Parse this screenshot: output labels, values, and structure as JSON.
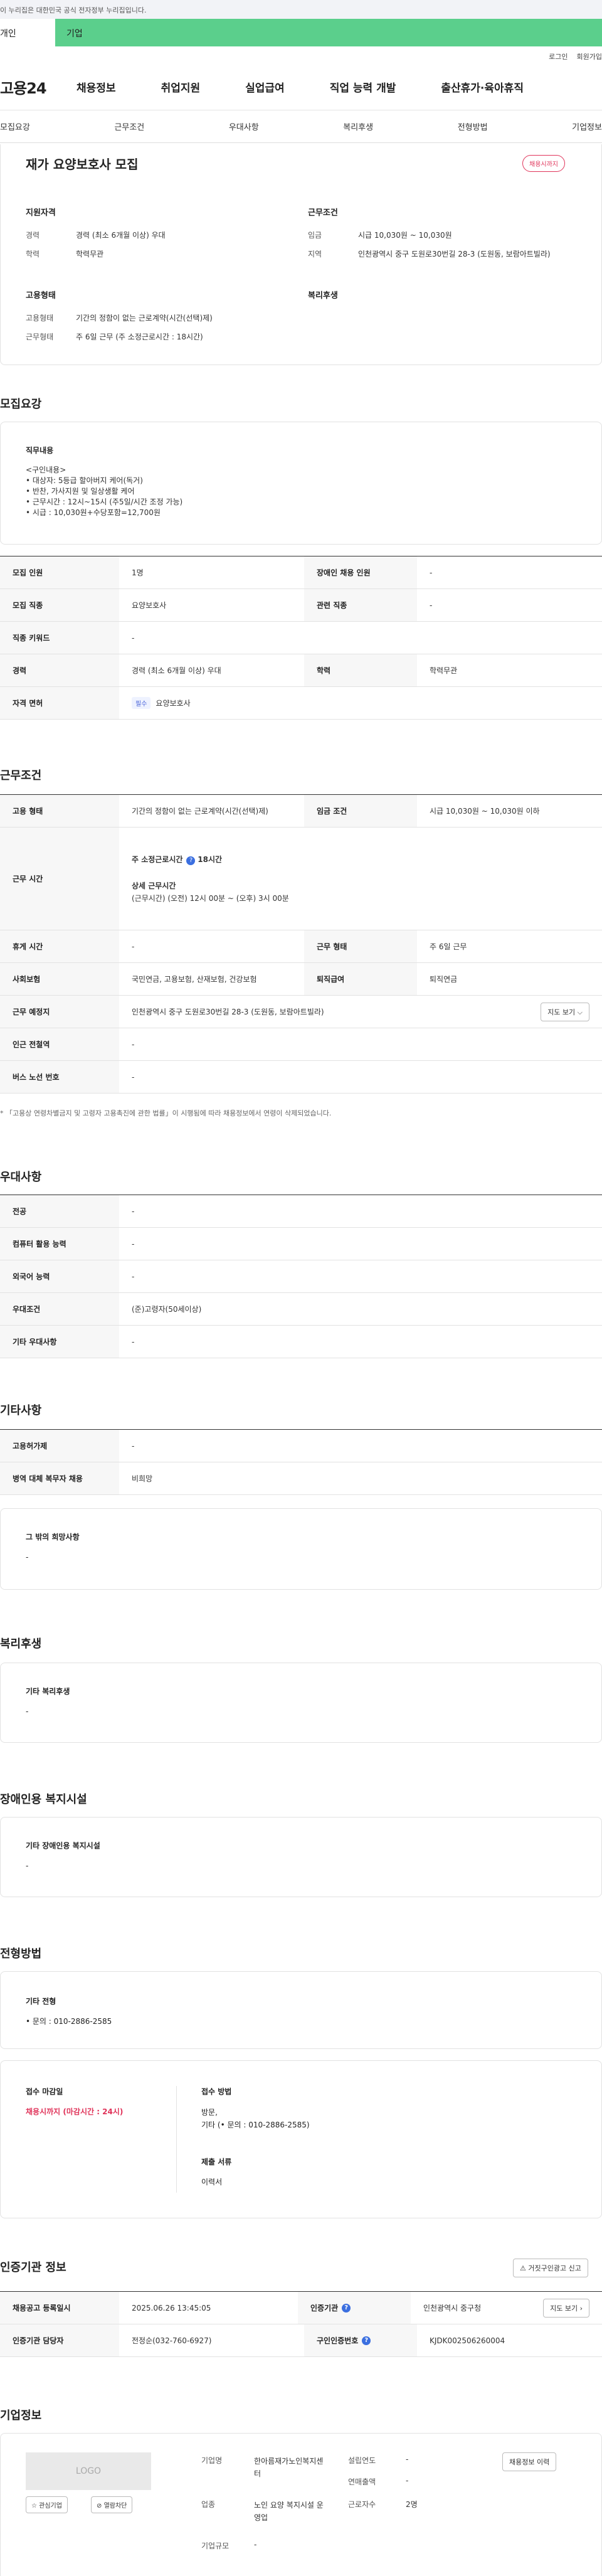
{
  "gov_banner": "이 누리집은 대한민국 공식 전자정부 누리집입니다.",
  "top_tabs": {
    "tab1": "개인",
    "tab2": "기업"
  },
  "util": {
    "login": "로그인",
    "join": "회원가입"
  },
  "header": {
    "logo": "고용24",
    "menu": [
      "채용정보",
      "취업지원",
      "실업급여",
      "직업 능력 개발",
      "출산휴가·육아휴직"
    ]
  },
  "subnav": [
    "모집요강",
    "근무조건",
    "우대사항",
    "복리후생",
    "전형방법",
    "기업정보"
  ],
  "job": {
    "title": "재가 요양보호사 모집",
    "status_badge": "채용시까지",
    "qual_head": "지원자격",
    "cond_head": "근무조건",
    "career_label": "경력",
    "career_value": "경력 (최소 6개월 이상) 우대",
    "edu_label": "학력",
    "edu_value": "학력무관",
    "wage_label": "임금",
    "wage_value": "시급 10,030원 ~ 10,030원",
    "area_label": "지역",
    "area_value": "인천광역시 중구 도원로30번길 28-3 (도원동, 보람아트빌라)",
    "emp_head": "고용형태",
    "welfare_head": "복리후생",
    "emp_label": "고용형태",
    "emp_value": "기간의 정함이 없는 근로계약(시간(선택)제)",
    "work_label": "근무형태",
    "work_value": "주 6일 근무 (주 소정근로시간 : 18시간)"
  },
  "recruit": {
    "heading": "모집요강",
    "duty_title": "직무내용",
    "duty_lines": [
      "<구인내용>",
      "• 대상자: 5등급 할아버지 케어(독거)",
      "• 반찬, 가사지원 및 일상생활 케어",
      "• 근무시간 : 12시~15시 (주5일/시간 조정 가능)",
      "• 시급 : 10,030원+수당포함=12,700원"
    ],
    "rows": [
      {
        "l1": "모집 인원",
        "v1": "1명",
        "l2": "장애인 채용 인원",
        "v2": "-"
      },
      {
        "l1": "모집 직종",
        "v1": "요양보호사",
        "l2": "관련 직종",
        "v2": "-"
      },
      {
        "l1": "직종 키워드",
        "v1": "-"
      },
      {
        "l1": "경력",
        "v1": "경력 (최소 6개월 이상) 우대",
        "l2": "학력",
        "v2": "학력무관"
      },
      {
        "l1": "자격 면허",
        "badge": "필수",
        "v1": "요양보호사"
      }
    ]
  },
  "conditions": {
    "heading": "근무조건",
    "emp_label": "고용 형태",
    "emp_value": "기간의 정함이 없는 근로계약(시간(선택)제)",
    "wage_label": "임금 조건",
    "wage_value": "시급 10,030원 ~ 10,030원 이하",
    "hours_label": "근무 시간",
    "hours_main": "주 소정근로시간",
    "hours_main_value": "18시간",
    "hours_detail_title": "상세 근무시간",
    "hours_detail": "(근무시간) (오전) 12시 00분 ~ (오후) 3시 00분",
    "rest_label": "휴게 시간",
    "rest_value": "-",
    "form_label": "근무 형태",
    "form_value": "주 6일 근무",
    "ins_label": "사회보험",
    "ins_value": "국민연금, 고용보험, 산재보험, 건강보험",
    "ret_label": "퇴직급여",
    "ret_value": "퇴직연금",
    "place_label": "근무 예정지",
    "place_value": "인천광역시 중구 도원로30번길 28-3 (도원동, 보람아트빌라)",
    "map_btn": "지도 보기",
    "station_label": "인근 전철역",
    "station_value": "-",
    "bus_label": "버스 노선 번호",
    "bus_value": "-",
    "note": "* 「고용상 연령차별금지 및 고령자 고용촉진에 관한 법률」이 시행됨에 따라 채용정보에서 연령이 삭제되었습니다."
  },
  "prefs": {
    "heading": "우대사항",
    "rows": [
      {
        "l": "전공",
        "v": "-"
      },
      {
        "l": "컴퓨터 활용 능력",
        "v": "-"
      },
      {
        "l": "외국어 능력",
        "v": "-"
      },
      {
        "l": "우대조건",
        "v": "(준)고령자(50세이상)"
      },
      {
        "l": "기타 우대사항",
        "v": "-"
      }
    ]
  },
  "etc": {
    "heading": "기타사항",
    "rows": [
      {
        "l": "고용허가제",
        "v": "-"
      },
      {
        "l": "병역 대체 복무자 채용",
        "v": "비희망"
      }
    ],
    "other_title": "그 밖의 희망사항",
    "other_value": "-"
  },
  "welfare": {
    "heading": "복리후생",
    "title": "기타 복리후생",
    "value": "-"
  },
  "disabled": {
    "heading": "장애인용 복지시설",
    "title": "기타 장애인용 복지시설",
    "value": "-"
  },
  "process": {
    "heading": "전형방법",
    "etc_title": "기타 전형",
    "etc_value": "• 문의 : 010-2886-2585",
    "deadline_title": "접수 마감일",
    "deadline_value": "채용시까지 (마감시간 : 24시)",
    "method_title": "접수 방법",
    "method_value1": "방문,",
    "method_value2": "기타 (• 문의 : 010-2886-2585)",
    "docs_title": "제출 서류",
    "docs_value": "이력서"
  },
  "cert": {
    "heading": "인증기관 정보",
    "report_btn": "거짓구인광고 신고",
    "reg_label": "채용공고 등록일시",
    "reg_value": "2025.06.26 13:45:05",
    "agency_label": "인증기관",
    "agency_value": "인천광역시 중구청",
    "map_btn": "지도 보기",
    "manager_label": "인증기관 담당자",
    "manager_value": "전정순(032-760-6927)",
    "num_label": "구인인증번호",
    "num_value": "KJDK002506260004"
  },
  "company": {
    "heading": "기업정보",
    "logo": "LOGO",
    "fav_btn": "관심기업",
    "block_btn": "열람차단",
    "name_label": "기업명",
    "name_value": "한아름재가노인복지센터",
    "year_label": "설립연도",
    "year_value": "-",
    "sales_label": "연매출액",
    "sales_value": "-",
    "ind_label": "업종",
    "ind_value": "노인 요양 복지시설 운영업",
    "emp_label": "근로자수",
    "emp_value": "2명",
    "size_label": "기업규모",
    "size_value": "-",
    "jobs_btn": "채용정보 이력"
  }
}
